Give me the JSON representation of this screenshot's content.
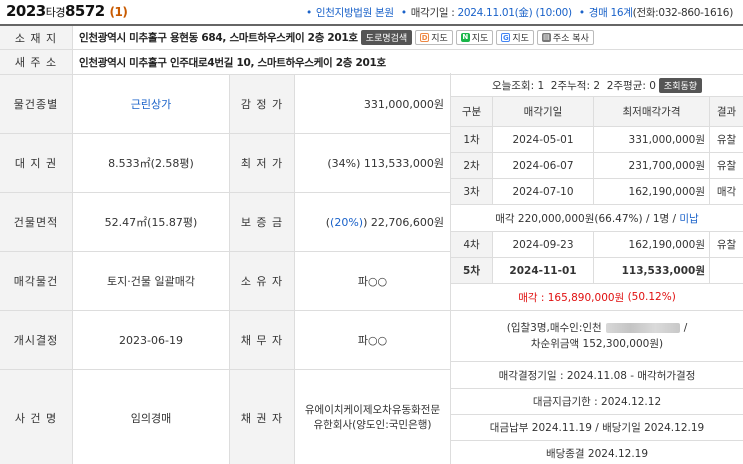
{
  "header": {
    "case_year": "2023",
    "case_type": "타경",
    "case_number": "8572",
    "case_count": "(1)",
    "court": "인천지방법원 본원",
    "sale_date_label": "매각기일 : ",
    "sale_date": "2024.11.01(金) (10:00)",
    "dept": "경매 16계",
    "phone": "(전화:032-860-1616)"
  },
  "address": {
    "label_old": "소 재 지",
    "old": "인천광역시 미추홀구 용현동 684, 스마트하우스케이 2층 201호",
    "label_new": "새 주 소",
    "new": "인천광역시 미추홀구 인주대로4번길 10, 스마트하우스케이 2층 201호",
    "btn_road": "도로명검색",
    "btn_daum": "지도",
    "btn_naver": "지도",
    "btn_google": "지도",
    "btn_copy": "주소 복사"
  },
  "info": {
    "usage_label": "물건종별",
    "usage": "근린상가",
    "appraisal_label": "감 정 가",
    "appraisal": "331,000,000원",
    "land_label": "대 지 권",
    "land": "8.533㎡(2.58평)",
    "min_label": "최 저 가",
    "min_rate": "(34%)",
    "min": "113,533,000원",
    "bldg_label": "건물면적",
    "bldg": "52.47㎡(15.87평)",
    "deposit_label": "보 증 금",
    "deposit_rate": "(20%)",
    "deposit": "22,706,600원",
    "sale_obj_label": "매각물건",
    "sale_obj": "토지·건물 일괄매각",
    "owner_label": "소 유 자",
    "owner": "파○○",
    "start_label": "개시결정",
    "start": "2023-06-19",
    "debtor_label": "채 무 자",
    "debtor": "파○○",
    "case_name_label": "사 건 명",
    "case_name": "임의경매",
    "creditor_label": "채 권 자",
    "creditor_line1": "유에이치케이제오차유동화전문",
    "creditor_line2": "유한회사(양도인:국민은행)"
  },
  "history": {
    "views": "오늘조회: 1  2주누적: 2  2주평균: 0",
    "views_btn": "조회동향",
    "col_round": "구분",
    "col_date": "매각기일",
    "col_price": "최저매각가격",
    "col_result": "결과",
    "rows": [
      {
        "round": "1차",
        "date": "2024-05-01",
        "price": "331,000,000원",
        "result": "유찰"
      },
      {
        "round": "2차",
        "date": "2024-06-07",
        "price": "231,700,000원",
        "result": "유찰"
      },
      {
        "round": "3차",
        "date": "2024-07-10",
        "price": "162,190,000원",
        "result": "매각"
      }
    ],
    "sale3_note": "매각 220,000,000원(66.47%) / 1명 / ",
    "sale3_status": "미납",
    "rows2": [
      {
        "round": "4차",
        "date": "2024-09-23",
        "price": "162,190,000원",
        "result": "유찰"
      },
      {
        "round": "5차",
        "date": "2024-11-01",
        "price": "113,533,000원",
        "result": ""
      }
    ],
    "final_sale_label": "매각 : ",
    "final_sale": "165,890,000원",
    "final_rate": "(50.12%)",
    "bidders_pre": "(입찰3명,매수인:인천",
    "bidders_post": "/",
    "runnerup": "차순위금액 152,300,000원)",
    "decision": "매각결정기일 : 2024.11.08 - 매각허가결정",
    "payment_due": "대금지급기한 : 2024.12.12",
    "payment": "대금납부 2024.11.19 / 배당기일 2024.12.19",
    "closed": "배당종결 2024.12.19"
  }
}
